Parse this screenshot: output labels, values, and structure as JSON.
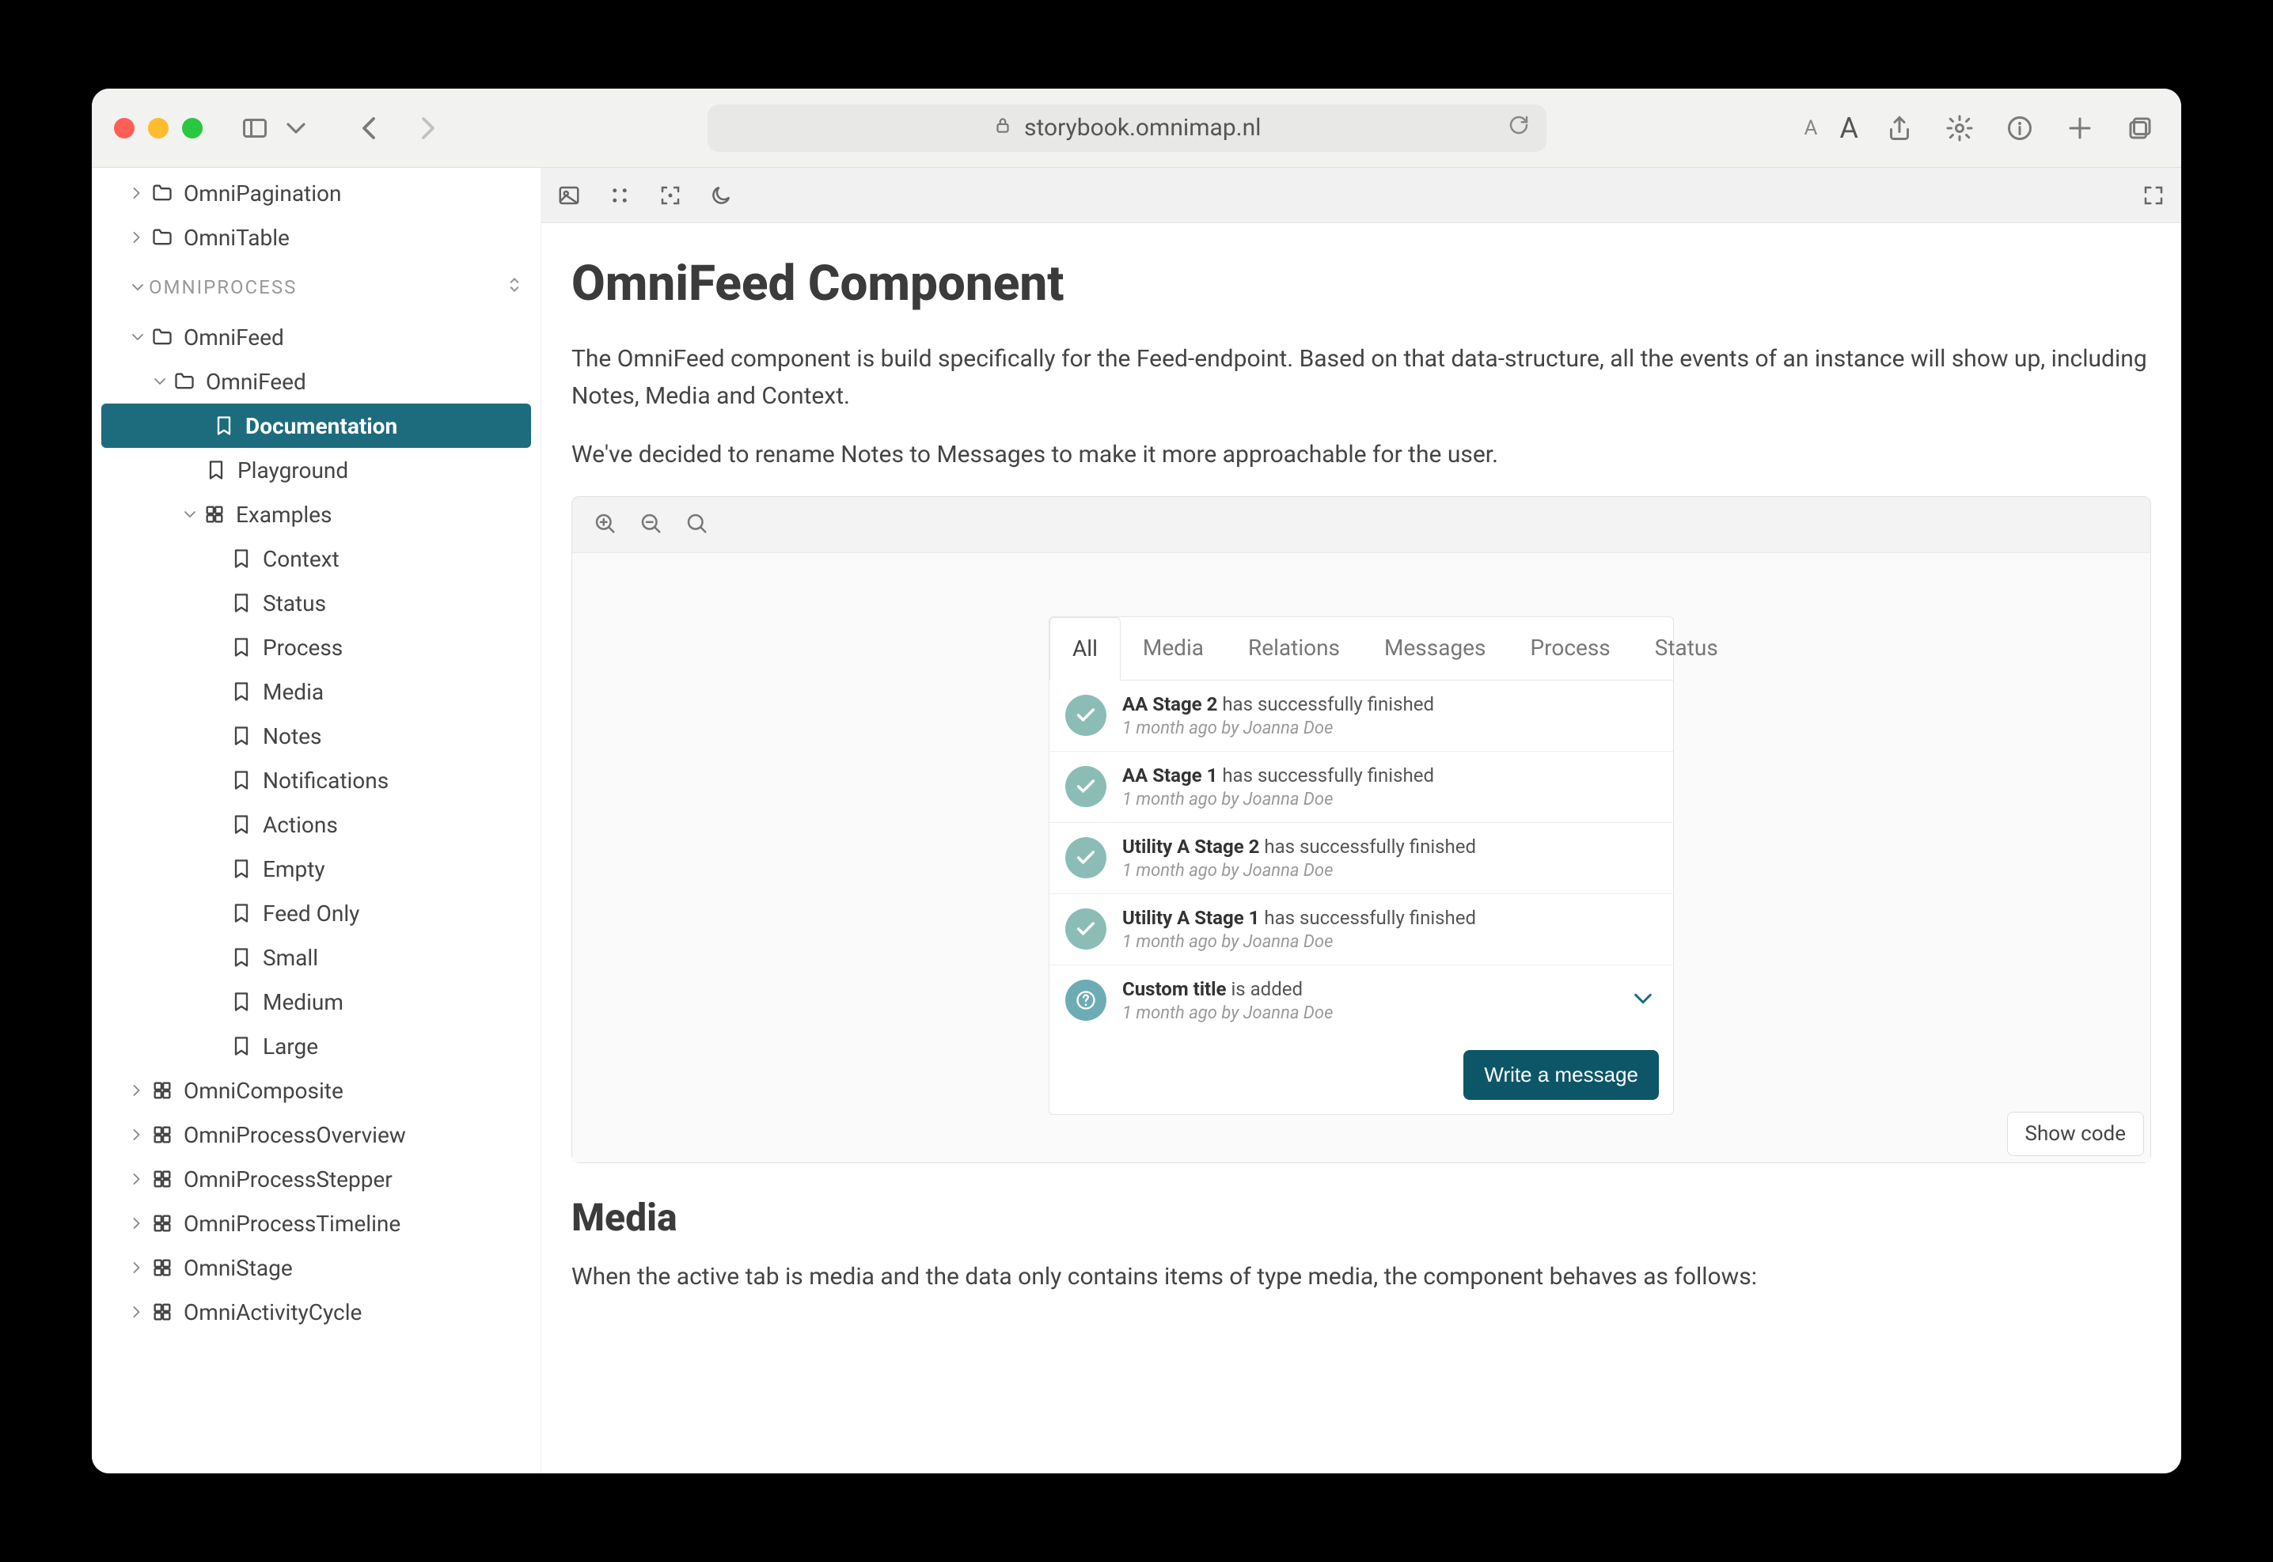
{
  "browser": {
    "url": "storybook.omnimap.nl"
  },
  "sidebar": {
    "top_items": [
      {
        "label": "OmniPagination",
        "icon": "folder"
      },
      {
        "label": "OmniTable",
        "icon": "folder"
      }
    ],
    "section": "OMNIPROCESS",
    "tree": {
      "root": {
        "label": "OmniFeed",
        "icon": "folder"
      },
      "child": {
        "label": "OmniFeed",
        "icon": "folder"
      },
      "doc": "Documentation",
      "playground": "Playground",
      "examples_label": "Examples",
      "examples": [
        "Context",
        "Status",
        "Process",
        "Media",
        "Notes",
        "Notifications",
        "Actions",
        "Empty",
        "Feed Only",
        "Small",
        "Medium",
        "Large"
      ],
      "siblings": [
        "OmniComposite",
        "OmniProcessOverview",
        "OmniProcessStepper",
        "OmniProcessTimeline",
        "OmniStage",
        "OmniActivityCycle"
      ]
    }
  },
  "page": {
    "title": "OmniFeed Component",
    "intro": "The OmniFeed component is build specifically for the Feed-endpoint. Based on that data-structure, all the events of an instance will show up, including Notes, Media and Context.",
    "intro2": "We've decided to rename Notes to Messages to make it more approachable for the user.",
    "show_code": "Show code",
    "media_heading": "Media",
    "media_text": "When the active tab is media and the data only contains items of type media, the component behaves as follows:"
  },
  "feed": {
    "tabs": [
      "All",
      "Media",
      "Relations",
      "Messages",
      "Process",
      "Status"
    ],
    "active_tab": 0,
    "items": [
      {
        "title": "AA Stage 2",
        "suffix": "has successfully finished",
        "sub": "1 month ago by Joanna Doe",
        "icon": "check"
      },
      {
        "title": "AA Stage 1",
        "suffix": "has successfully finished",
        "sub": "1 month ago by Joanna Doe",
        "icon": "check"
      },
      {
        "title": "Utility A Stage 2",
        "suffix": "has successfully finished",
        "sub": "1 month ago by Joanna Doe",
        "icon": "check"
      },
      {
        "title": "Utility A Stage 1",
        "suffix": "has successfully finished",
        "sub": "1 month ago by Joanna Doe",
        "icon": "check"
      },
      {
        "title": "Custom title",
        "suffix": "is added",
        "sub": "1 month ago by Joanna Doe",
        "icon": "question",
        "expand": true
      }
    ],
    "button": "Write a message"
  }
}
